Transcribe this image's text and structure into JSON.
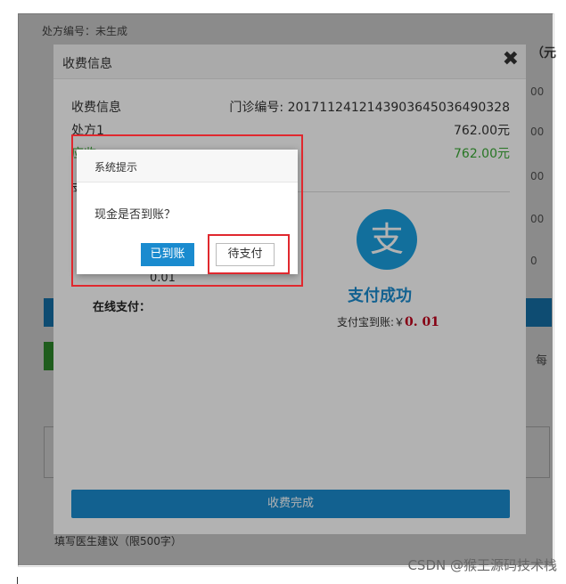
{
  "background": {
    "prescription_status": "处方编号：未生成",
    "col_header": "（元",
    "right_cells": [
      "00",
      "00",
      "00",
      "00",
      "0"
    ],
    "right_char": "每",
    "advice": "填写医生建议（限500字）"
  },
  "modal": {
    "title": "收费信息",
    "close_label": "✖",
    "fee_info_label": "收费信息",
    "clinic_no_label": "门诊编号: 20171124121439036450364903​28",
    "prescription1_label": "处方1",
    "prescription1_value": "762.00元",
    "total_label": "应收",
    "total_value": "762.00元",
    "pay_label": "支",
    "amount_value": "0.01",
    "online_pay_label": "在线支付：",
    "alipay_glyph": "支",
    "pay_success": "支付成功",
    "pay_received_label": "支付宝到账:￥",
    "pay_received_amount": "0. 01",
    "finish_button": "收费完成"
  },
  "prompt": {
    "title": "系统提示",
    "message": "现金是否到账？",
    "arrived_button": "已到账",
    "pending_button": "待支付"
  },
  "watermark": "CSDN @猴王源码技术栈",
  "colors": {
    "primary_blue": "#1a8bcf",
    "alipay_blue": "#1aa0e0",
    "success_green": "#3aaa35",
    "highlight_red": "#e0282e",
    "amount_red": "#c0001c"
  }
}
